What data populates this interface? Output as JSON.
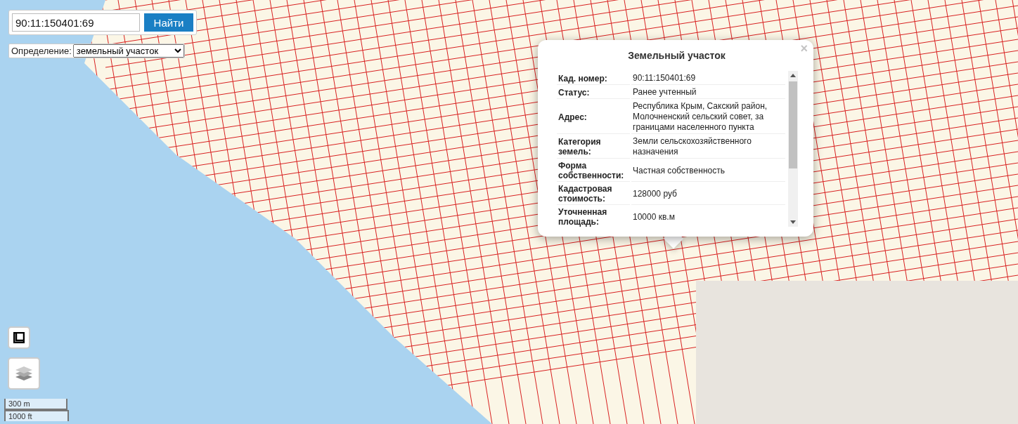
{
  "search": {
    "value": "90:11:150401:69",
    "button": "Найти"
  },
  "definition": {
    "label": "Определение:",
    "value": "земельный участок"
  },
  "popup": {
    "title": "Земельный участок",
    "close": "×",
    "rows": [
      {
        "label": "Кад. номер:",
        "value": "90:11:150401:69"
      },
      {
        "label": "Статус:",
        "value": "Ранее учтенный"
      },
      {
        "label": "Адрес:",
        "value": "Республика Крым, Сакский район, Молочненский сельский совет, за границами населенного пункта"
      },
      {
        "label": "Категория земель:",
        "value": "Земли сельскохозяйственного назначения"
      },
      {
        "label": "Форма собственности:",
        "value": "Частная собственность"
      },
      {
        "label": "Кадастровая стоимость:",
        "value": "128000 руб"
      },
      {
        "label": "Уточненная площадь:",
        "value": "10000 кв.м"
      }
    ]
  },
  "scale": [
    "300 m",
    "1000 ft"
  ]
}
